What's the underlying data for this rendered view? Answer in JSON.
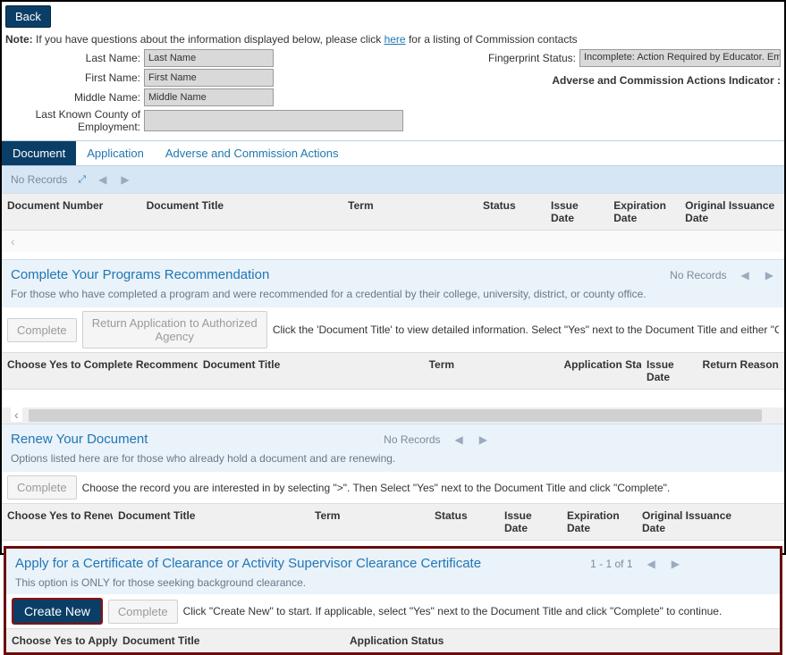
{
  "back_label": "Back",
  "note": {
    "prefix": "Note:",
    "text_before": " If you have questions about the information displayed below, please click ",
    "link": "here",
    "text_after": " for a listing of Commission contacts"
  },
  "fields": {
    "last_name_label": "Last Name:",
    "last_name_value": "Last Name",
    "first_name_label": "First Name:",
    "first_name_value": "First Name",
    "middle_name_label": "Middle Name:",
    "middle_name_value": "Middle Name",
    "county_label": "Last Known County of Employment:",
    "county_value": ""
  },
  "fingerprint": {
    "label": "Fingerprint Status:",
    "value": "Incomplete: Action Required by Educator. Email Fil"
  },
  "indicator_label": "Adverse and Commission Actions Indicator :",
  "tabs": {
    "document": "Document",
    "application": "Application",
    "actions": "Adverse and Commission Actions"
  },
  "no_records": "No Records",
  "columns1": {
    "doc_num": "Document Number",
    "doc_title": "Document Title",
    "term": "Term",
    "status": "Status",
    "issue": "Issue Date",
    "exp": "Expiration Date",
    "orig": "Original Issuance Date"
  },
  "section_complete": {
    "title": "Complete Your Programs Recommendation",
    "subtitle": "For those who have completed a program and were recommended for a credential by their college, university, district, or county office.",
    "btn_complete": "Complete",
    "btn_return": "Return Application to Authorized Agency",
    "hint": "Click the 'Document Title' to view detailed information. Select \"Yes\" next to the Document Title and either \"Complete\", or \"Return Appli",
    "cols": {
      "a": "Choose Yes to Complete Recommendation",
      "b": "Document Title",
      "c": "Term",
      "d": "Application Statu",
      "e": "Issue Date",
      "f": "Return Reason"
    }
  },
  "section_renew": {
    "title": "Renew Your Document",
    "subtitle": "Options listed here are for those who already hold a document and are renewing.",
    "btn_complete": "Complete",
    "hint": "Choose the record you are interested in by selecting \">\". Then Select \"Yes\" next to the Document Title and click \"Complete\".",
    "cols": {
      "a": "Choose Yes to Renew",
      "b": "Document Title",
      "c": "Term",
      "d": "Status",
      "e": "Issue Date",
      "f": "Expiration Date",
      "g": "Original Issuance Date"
    }
  },
  "section_apply": {
    "title": "Apply for a Certificate of Clearance or Activity Supervisor Clearance Certificate",
    "subtitle": "This option is ONLY for those seeking background clearance.",
    "btn_create": "Create New",
    "btn_complete": "Complete",
    "hint": "Click \"Create New\" to start. If applicable, select \"Yes\" next to the Document Title and click \"Complete\" to continue.",
    "page_text": "1 - 1 of 1",
    "cols": {
      "a": "Choose Yes to Apply",
      "b": "Document Title",
      "c": "Application Status"
    }
  },
  "chevrons": {
    "left": "‹",
    "right": "›",
    "tri_left": "◀",
    "tri_right": "▶",
    "expand": "⤢"
  }
}
